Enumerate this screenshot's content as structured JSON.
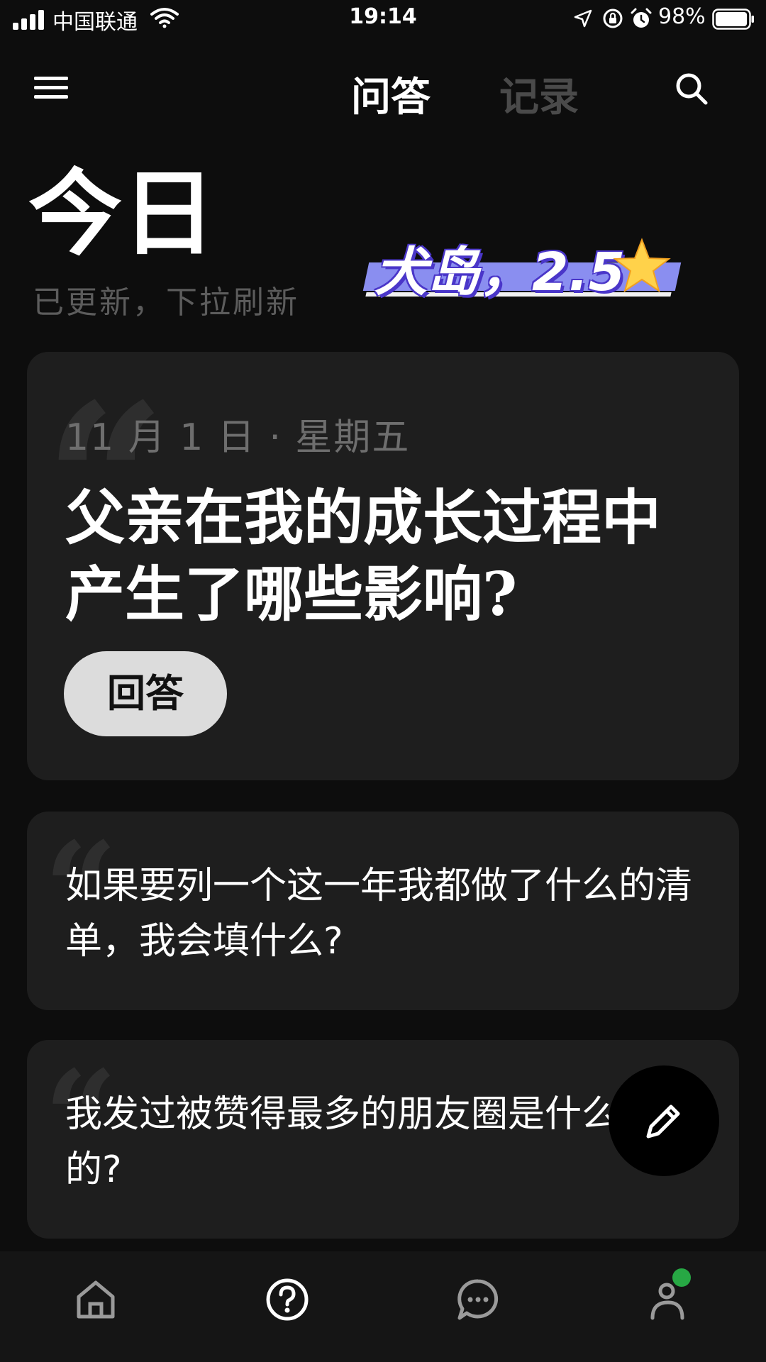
{
  "status_bar": {
    "carrier": "中国联通",
    "time": "19:14",
    "battery_percent": "98%",
    "battery_level": 0.98,
    "icons": [
      "signal-icon",
      "wifi-icon",
      "location-arrow-icon",
      "rotation-lock-icon",
      "alarm-icon",
      "battery-icon"
    ]
  },
  "header": {
    "tabs": [
      {
        "label": "问答",
        "active": true
      },
      {
        "label": "记录",
        "active": false
      }
    ],
    "icons": [
      "menu-icon",
      "search-icon"
    ]
  },
  "today": {
    "title": "今日",
    "subtitle": "已更新，下拉刷新"
  },
  "sticker": {
    "text": "犬岛，2.5",
    "icon": "star-icon",
    "colors": {
      "band": "#8a8ef0",
      "outline": "#4a36c9",
      "star": "#ffd24a"
    }
  },
  "cards": [
    {
      "date": "11 月 1 日 · 星期五",
      "question": "父亲在我的成长过程中产生了哪些影响?",
      "button_label": "回答"
    },
    {
      "question": "如果要列一个这一年我都做了什么的清单，我会填什么?"
    },
    {
      "question": "我发过被赞得最多的朋友圈是什么样的?"
    }
  ],
  "fab": {
    "icon": "pencil-icon"
  },
  "bottom_nav": {
    "items": [
      {
        "icon": "home-icon"
      },
      {
        "icon": "question-icon",
        "active": true
      },
      {
        "icon": "chat-bubble-icon"
      },
      {
        "icon": "profile-icon",
        "badge_color": "#27a844"
      }
    ]
  },
  "colors": {
    "background": "#0d0d0d",
    "card": "#1e1e1e",
    "inactive_tab": "#4a4a4a",
    "accent_badge": "#27a844"
  }
}
